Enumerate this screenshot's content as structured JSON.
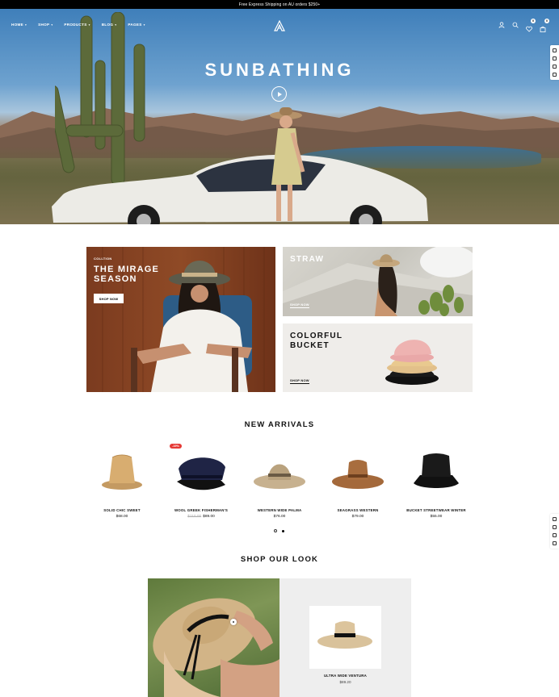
{
  "announcement": "Free Express Shipping on AU orders $250+",
  "nav": [
    {
      "label": "HOME"
    },
    {
      "label": "SHOP"
    },
    {
      "label": "PRODUCTS"
    },
    {
      "label": "BLOG"
    },
    {
      "label": "PAGES"
    }
  ],
  "header": {
    "wishlist_count": "0",
    "cart_count": "0"
  },
  "hero": {
    "title": "SUNBATHING"
  },
  "collections": {
    "mirage": {
      "kicker": "COLLTION",
      "title_line1": "THE MIRAGE",
      "title_line2": "SEASON",
      "button": "SHOP NOW"
    },
    "straw": {
      "title": "STRAW",
      "button": "SHOP NOW"
    },
    "bucket": {
      "title_line1": "COLORFUL",
      "title_line2": "BUCKET",
      "button": "SHOP NOW"
    }
  },
  "new_arrivals": {
    "title": "NEW ARRIVALS",
    "badge": "-19%",
    "products": [
      {
        "name": "SOLID CHIC SWEET",
        "old_price": "",
        "price": "$68.00"
      },
      {
        "name": "WOOL GREEK FISHERMAN'S",
        "old_price": "$110.00",
        "price": "$89.00"
      },
      {
        "name": "WESTERN WIDE PALMA",
        "old_price": "",
        "price": "$76.00"
      },
      {
        "name": "SEAGRASS WESTERN",
        "old_price": "",
        "price": "$79.00"
      },
      {
        "name": "BUCKET STREETWEAR WINTER",
        "old_price": "",
        "price": "$55.00"
      }
    ]
  },
  "shop_look": {
    "title": "SHOP OUR LOOK",
    "product_name": "ULTRA WIDE VENTURA",
    "product_price": "$89.20"
  },
  "colors": {
    "sale_badge": "#e53935",
    "announcement_bg": "#000000"
  }
}
